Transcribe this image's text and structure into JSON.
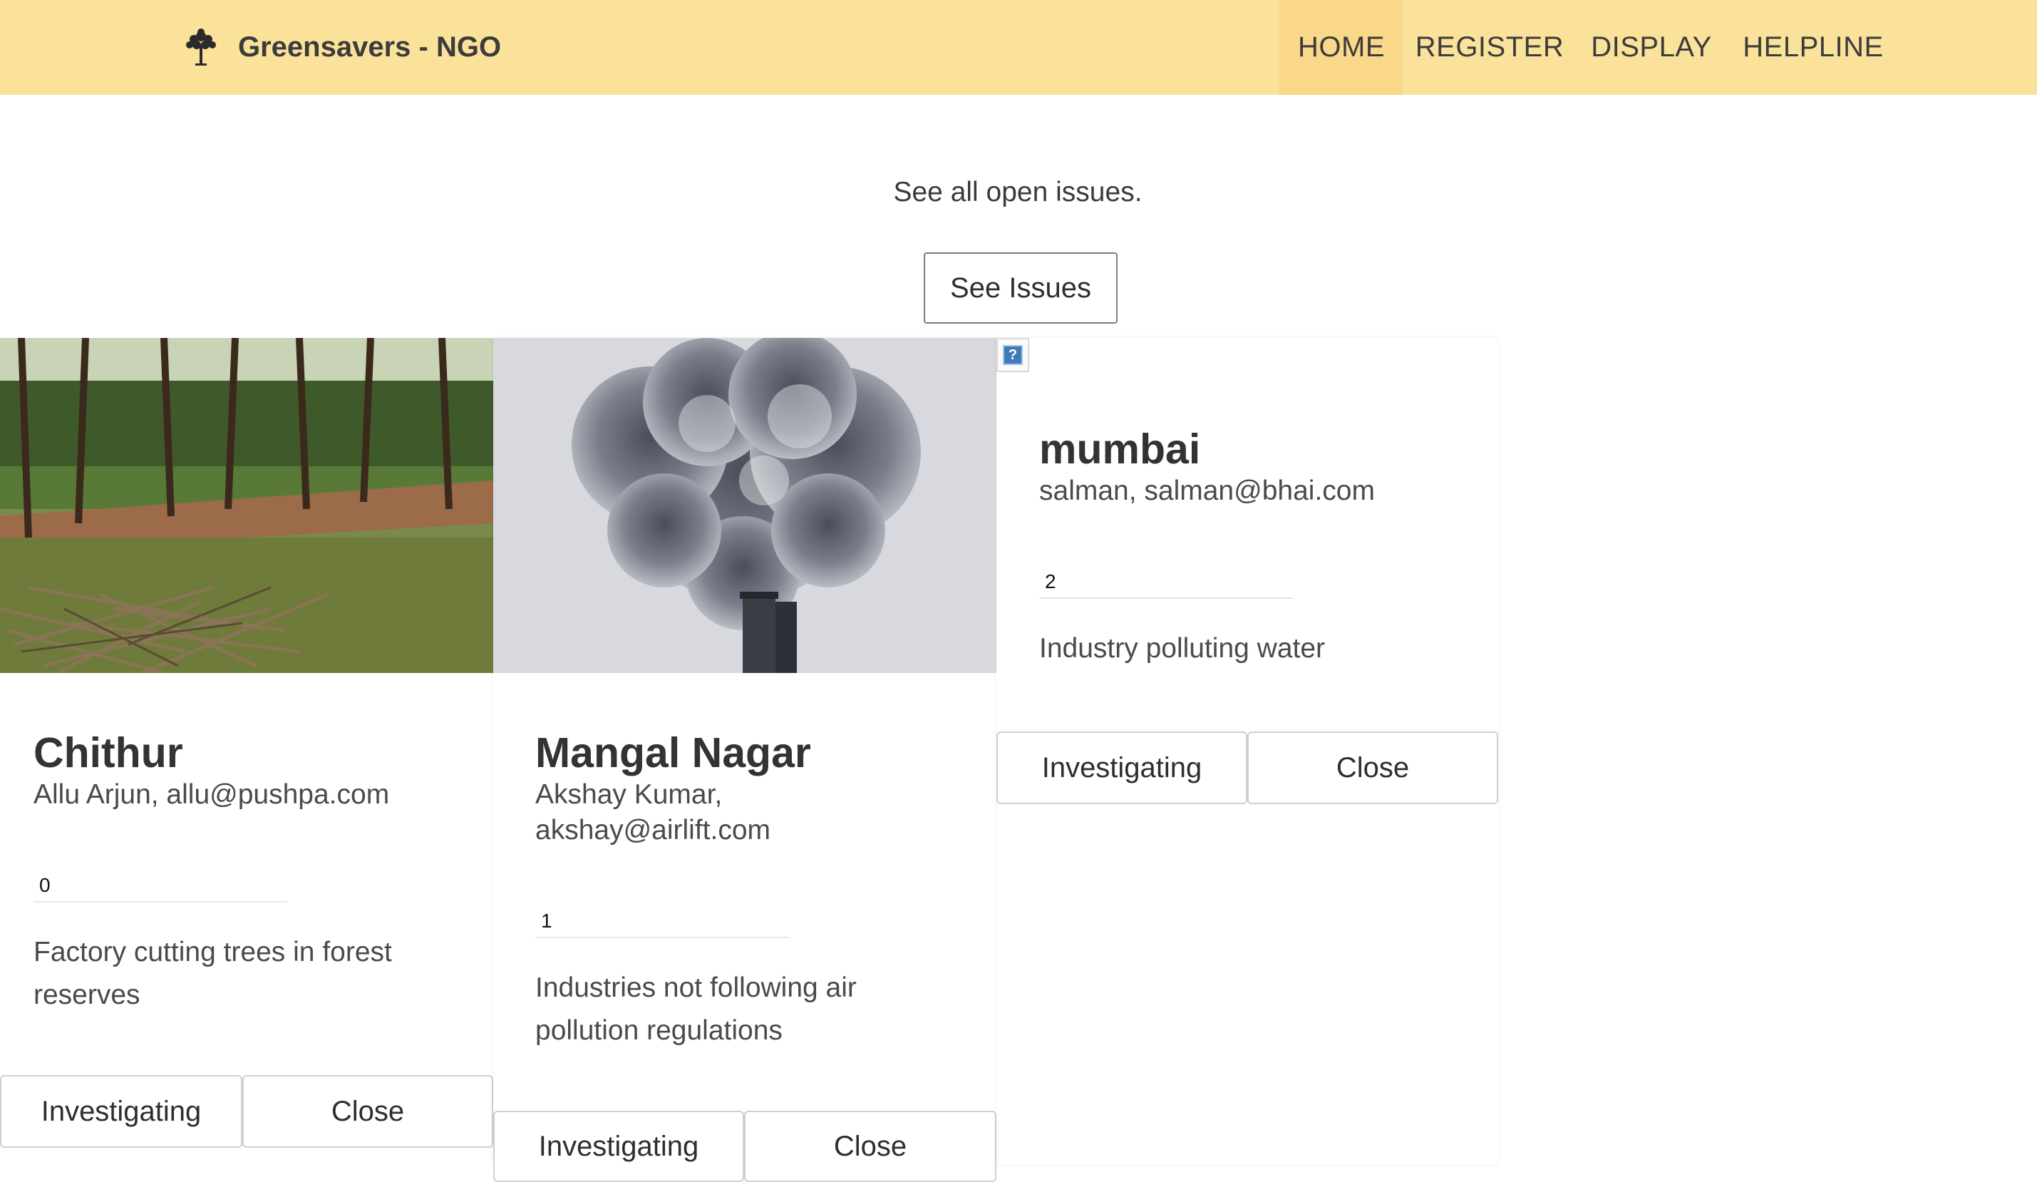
{
  "navbar": {
    "brand": "Greensavers - NGO",
    "brand_icon": "tree-icon",
    "items": [
      {
        "label": "HOME",
        "active": true
      },
      {
        "label": "REGISTER",
        "active": false
      },
      {
        "label": "DISPLAY",
        "active": false
      },
      {
        "label": "HELPLINE",
        "active": false
      }
    ],
    "bg_color": "#fbe29a",
    "active_color": "#fad889"
  },
  "hero": {
    "lead": "See all open issues.",
    "button_label": "See Issues"
  },
  "issues": [
    {
      "image": "forest-clearing-photo",
      "location": "Chithur",
      "reporter": "Allu Arjun, allu@pushpa.com",
      "count": "0",
      "description": "Factory cutting trees in forest reserves",
      "actions": [
        "Investigating",
        "Close"
      ]
    },
    {
      "image": "smokestack-pollution-photo",
      "location": "Mangal Nagar",
      "reporter": "Akshay Kumar, akshay@airlift.com",
      "count": "1",
      "description": "Industries not following air pollution regulations",
      "actions": [
        "Investigating",
        "Close"
      ]
    },
    {
      "image": "broken-image-icon",
      "location": "mumbai",
      "reporter": "salman, salman@bhai.com",
      "count": "2",
      "description": "Industry polluting water",
      "actions": [
        "Investigating",
        "Close"
      ]
    }
  ]
}
